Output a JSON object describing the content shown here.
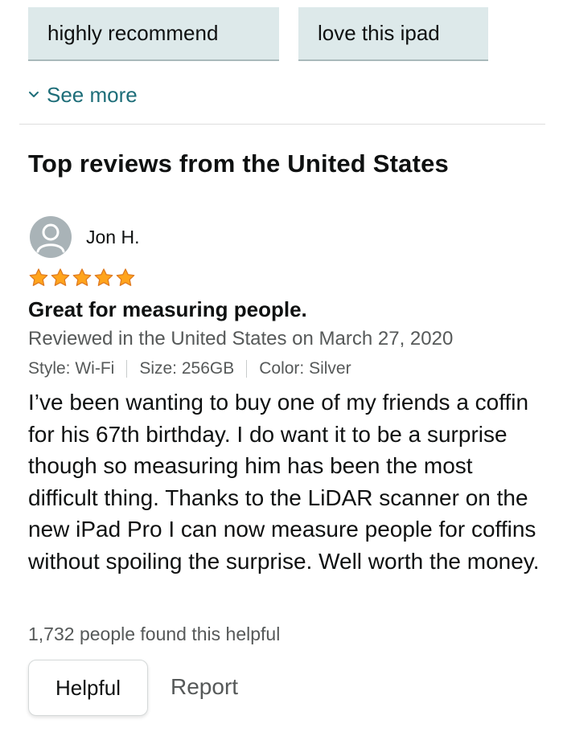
{
  "filter_chips": [
    {
      "label": "highly recommend"
    },
    {
      "label": "love this ipad"
    }
  ],
  "see_more": {
    "label": "See more",
    "icon": "chevron-down-icon"
  },
  "reviews_section": {
    "title": "Top reviews from the United States"
  },
  "review": {
    "reviewer_name": "Jon H.",
    "avatar_icon": "user-avatar-icon",
    "rating": 5,
    "rating_max": 5,
    "star_color": "#ffa41c",
    "title": "Great for measuring people.",
    "date_line": "Reviewed in the United States on March 27, 2020",
    "variants": {
      "style": "Style: Wi-Fi",
      "size": "Size: 256GB",
      "color": "Color: Silver"
    },
    "body": "I’ve been wanting to buy one of my friends a coffin for his 67th birthday. I do want it to be a surprise though so measuring him has been the most difficult thing. Thanks to the LiDAR scanner on the new iPad Pro I can now measure people for coffins without spoiling the surprise. Well worth the money.",
    "helpful_count": "1,732 people found this helpful",
    "helpful_button": "Helpful",
    "report_link": "Report"
  },
  "colors": {
    "link": "#1e6e79",
    "chip_bg": "#dde9ea",
    "secondary_text": "#565959"
  }
}
